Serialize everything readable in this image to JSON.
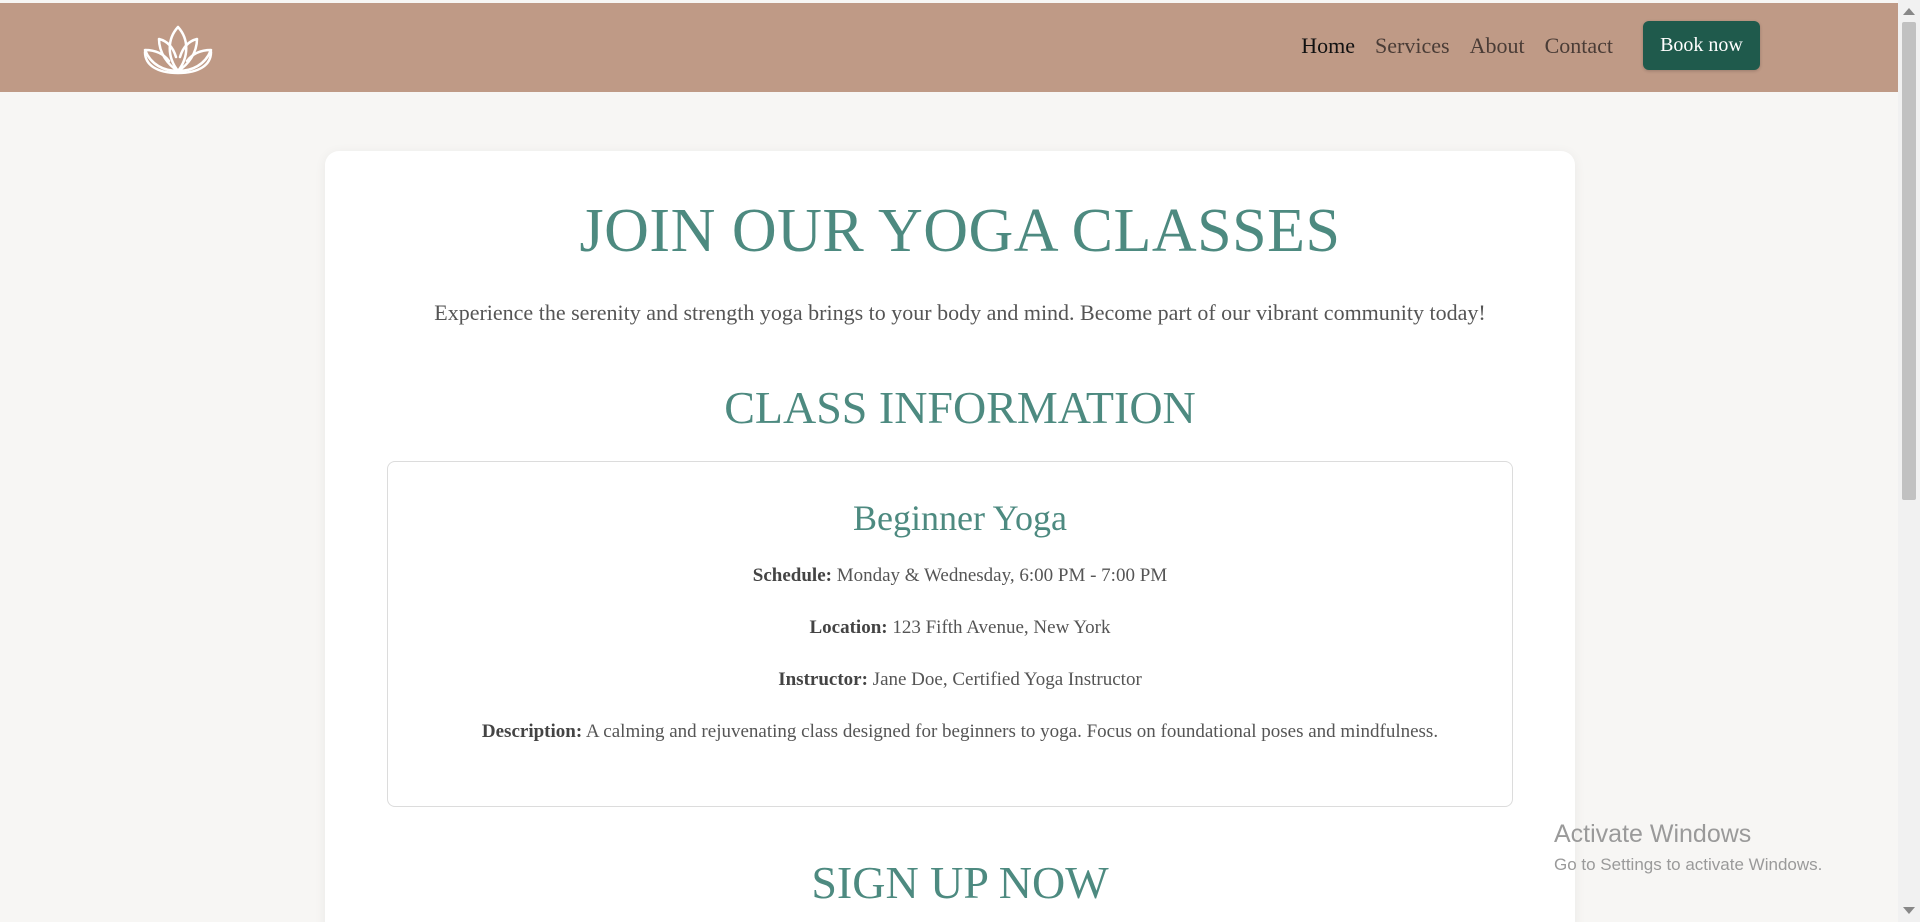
{
  "header": {
    "logo": "lotus-icon",
    "nav": [
      "Home",
      "Services",
      "About",
      "Contact"
    ],
    "active_nav": "Home",
    "book_button": "Book now",
    "background_color": "#bf9a86",
    "button_color": "#1f5a4c"
  },
  "hero": {
    "title": "JOIN OUR YOGA CLASSES",
    "subtitle": "Experience the serenity and strength yoga brings to your body and mind. Become part of our vibrant community today!"
  },
  "class_info": {
    "section_title": "CLASS INFORMATION",
    "class_name": "Beginner Yoga",
    "details": [
      {
        "label": "Schedule:",
        "value": "Monday & Wednesday, 6:00 PM - 7:00 PM"
      },
      {
        "label": "Location:",
        "value": "123 Fifth Avenue, New York"
      },
      {
        "label": "Instructor:",
        "value": "Jane Doe, Certified Yoga Instructor"
      },
      {
        "label": "Description:",
        "value": "A calming and rejuvenating class designed for beginners to yoga. Focus on foundational poses and mindfulness."
      }
    ]
  },
  "signup": {
    "section_title": "SIGN UP NOW"
  },
  "watermark": {
    "title": "Activate Windows",
    "subtitle": "Go to Settings to activate Windows."
  }
}
